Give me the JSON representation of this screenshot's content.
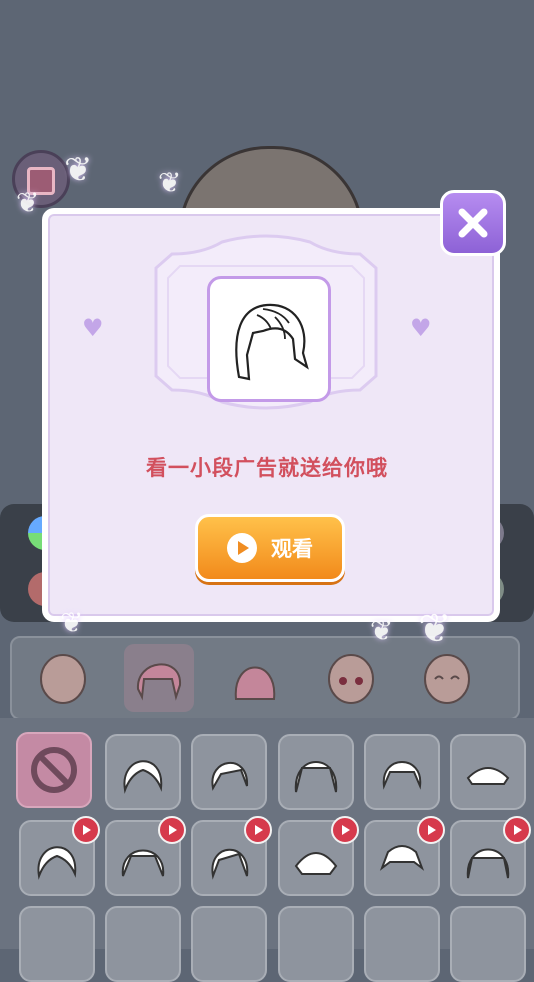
{
  "dialog": {
    "message": "看一小段广告就送给你哦",
    "watch_label": "观看"
  },
  "icons": {
    "close": "close-icon",
    "play": "play-icon",
    "ad_badge": "video-ad-icon",
    "none": "no-selection-icon"
  },
  "colors": {
    "accent_purple": "#8d62d6",
    "button_orange": "#f28a1b",
    "text_red": "#d2505e",
    "dialog_bg": "#efe7f7"
  },
  "tabs": [
    "face-base",
    "hair",
    "back-hair",
    "face",
    "expression"
  ],
  "grid_items": 18
}
